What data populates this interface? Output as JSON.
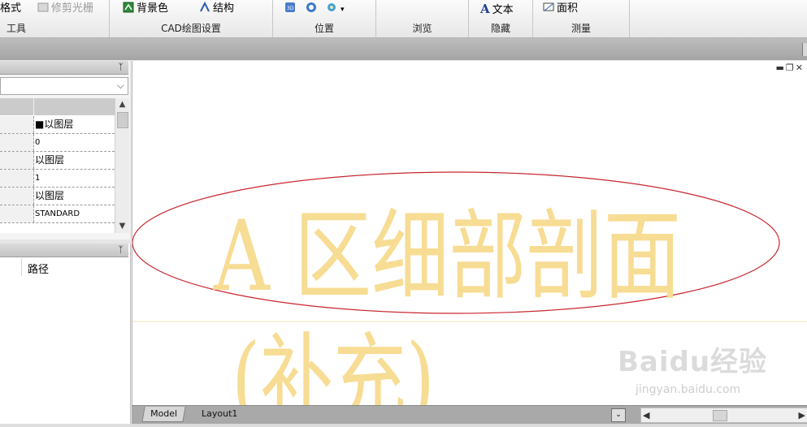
{
  "ribbon": {
    "groups": [
      {
        "caption": "工具",
        "buttons": [
          {
            "label": "格式",
            "icon": "format-icon"
          },
          {
            "label": "修剪光栅",
            "icon": "trim-raster-icon",
            "disabled": true
          }
        ]
      },
      {
        "caption": "CAD绘图设置",
        "buttons": [
          {
            "label": "背景色",
            "icon": "background-color-icon"
          },
          {
            "label": "结构",
            "icon": "structure-icon"
          }
        ]
      },
      {
        "caption": "位置",
        "buttons": [
          {
            "label": "",
            "icon": "3d-orbit-icon"
          },
          {
            "label": "",
            "icon": "zoom-icon"
          },
          {
            "label": "",
            "icon": "view-dropdown-icon"
          }
        ]
      },
      {
        "caption": "浏览",
        "buttons": []
      },
      {
        "caption": "隐藏",
        "buttons": [
          {
            "label": "文本",
            "icon": "text-a-icon"
          }
        ]
      },
      {
        "caption": "测量",
        "buttons": [
          {
            "label": "面积",
            "icon": "area-measure-icon"
          }
        ]
      }
    ]
  },
  "properties": {
    "rows": [
      {
        "value": "■以图层"
      },
      {
        "value": "0"
      },
      {
        "value": "以图层"
      },
      {
        "value": "1"
      },
      {
        "value": "以图层"
      },
      {
        "value": "STANDARD"
      }
    ]
  },
  "path_panel": {
    "column_label": "路径"
  },
  "drawing": {
    "title_text": "A 区细部剖面",
    "subtitle_text": "(补充)",
    "text_color": "#f7dc93",
    "ellipse_color": "#c8262e",
    "line_color": "#f5e6b3"
  },
  "tabs": {
    "model": "Model",
    "layout": "Layout1"
  },
  "watermark": {
    "brand": "Baidu经验",
    "url": "jingyan.baidu.com"
  }
}
